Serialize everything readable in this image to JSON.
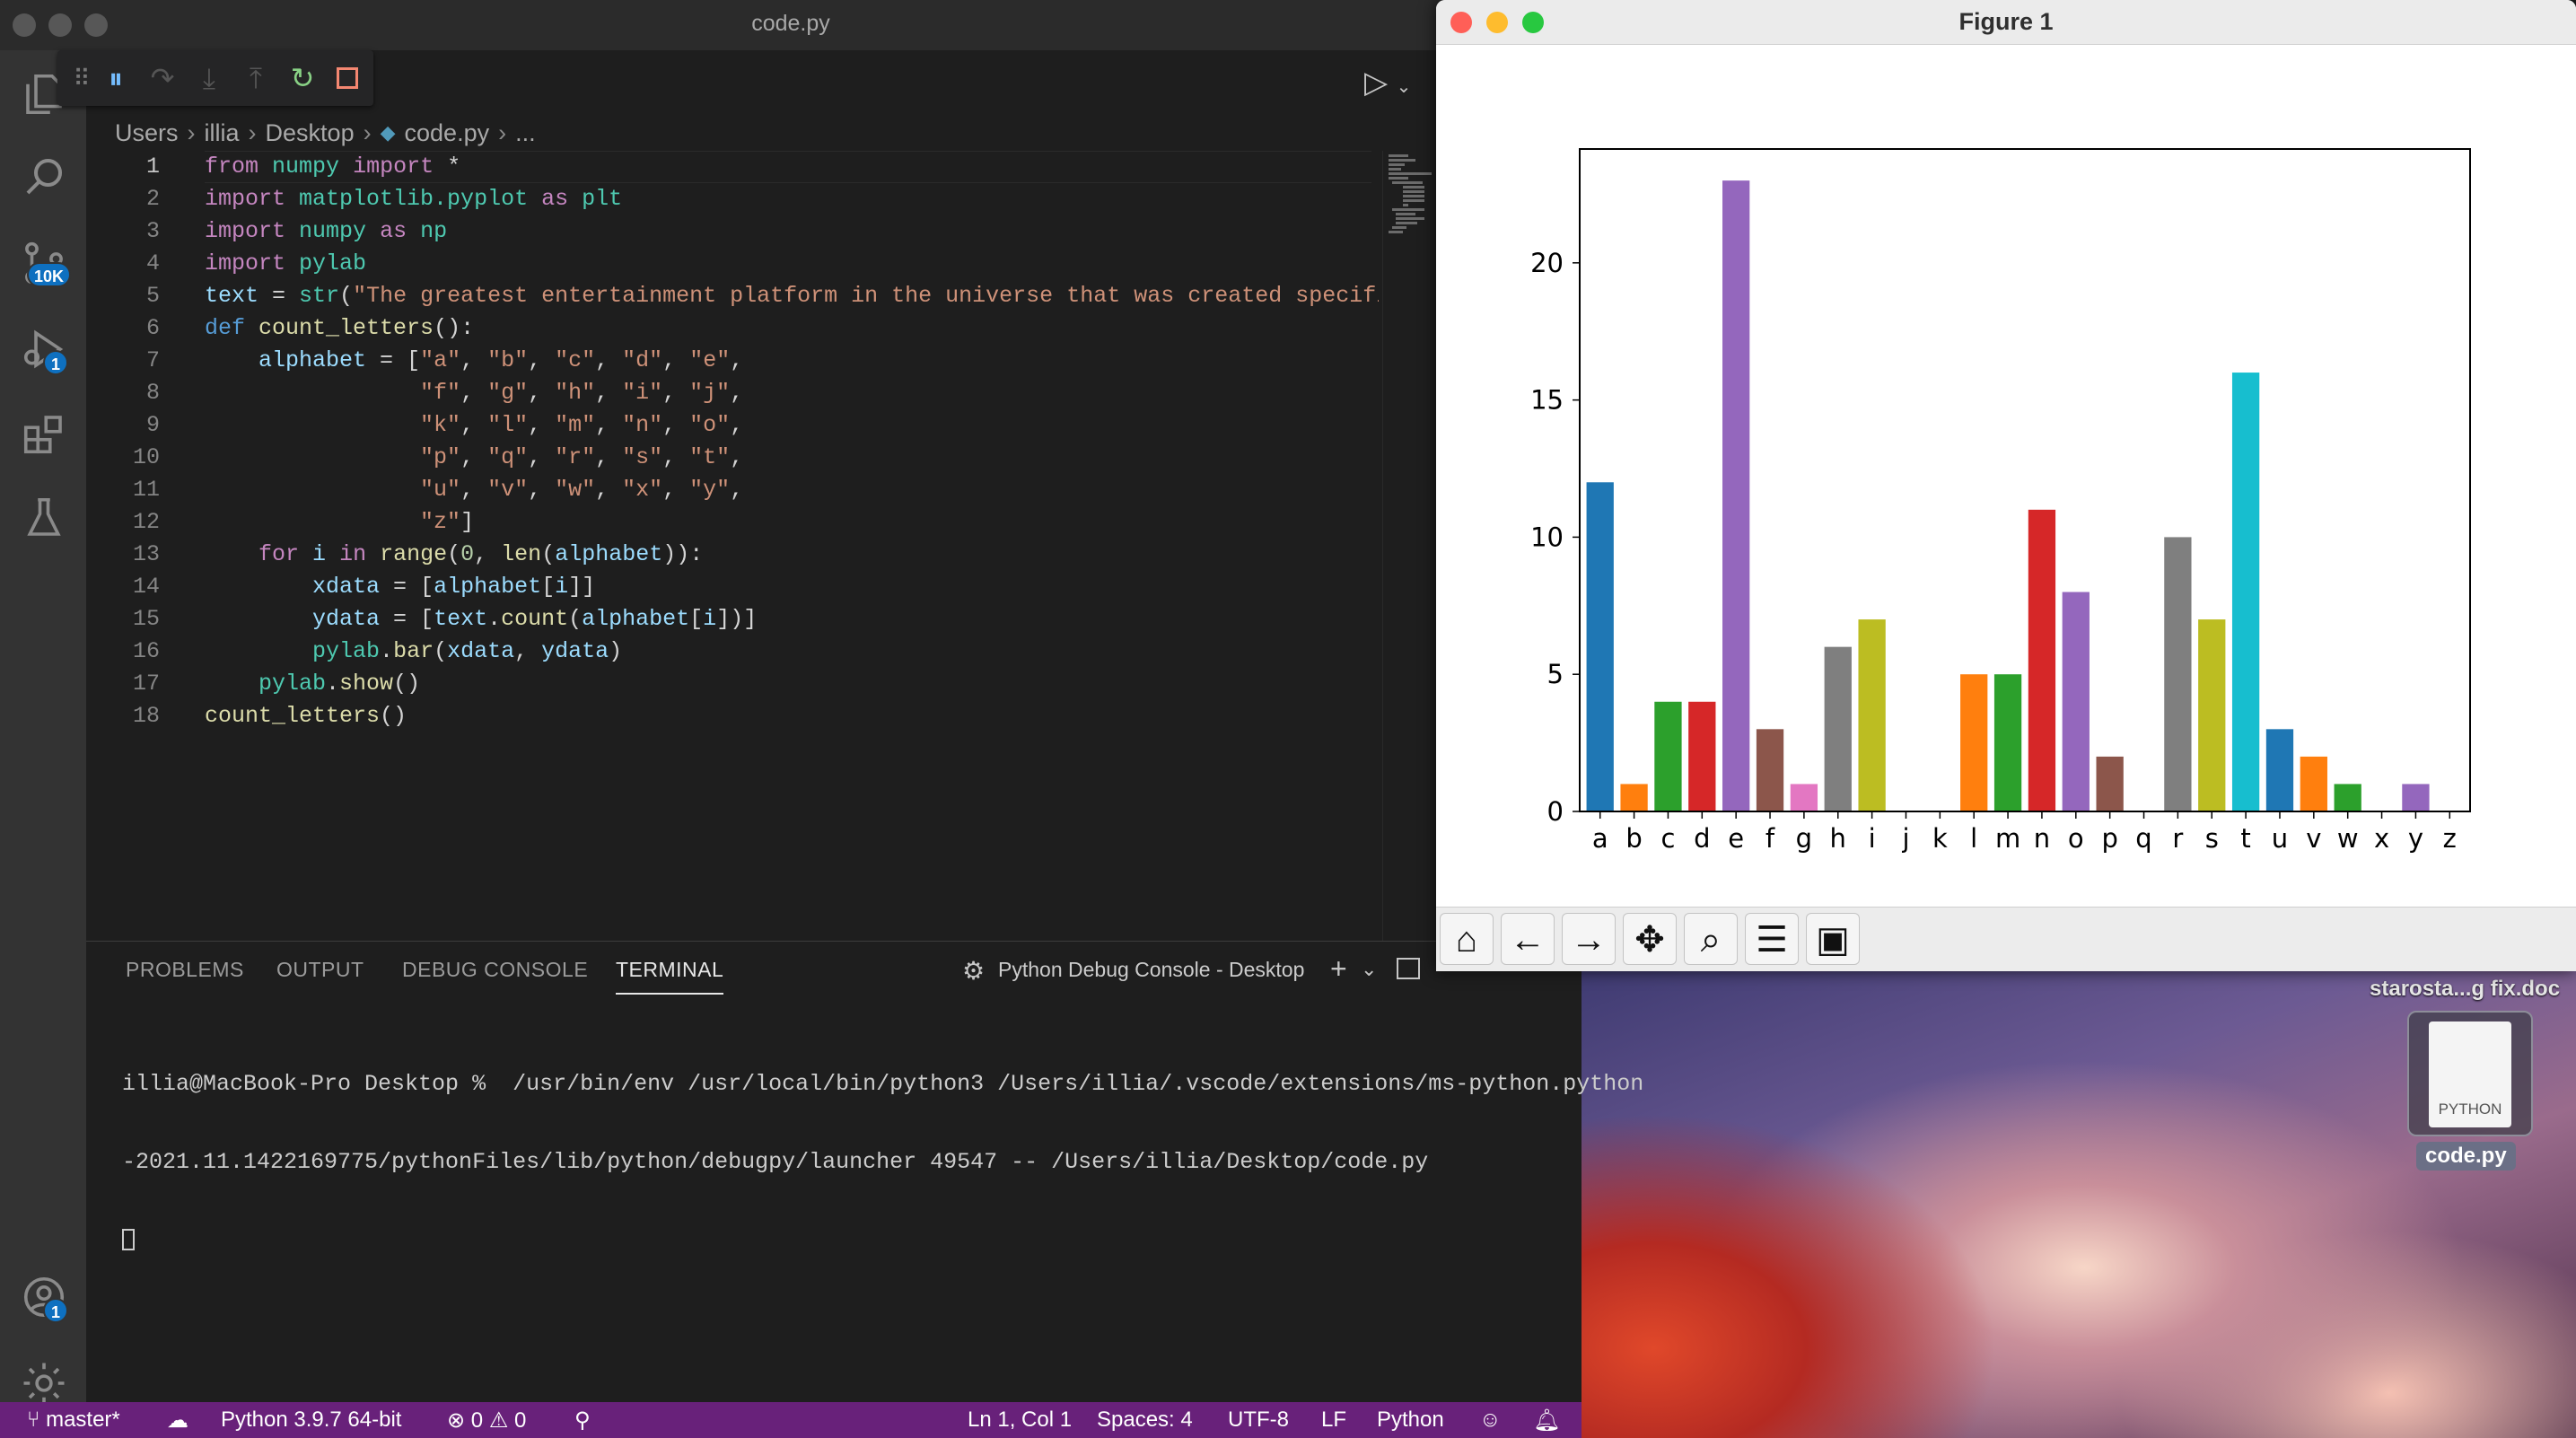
{
  "vscode": {
    "title": "code.py",
    "breadcrumb": [
      "Users",
      "illia",
      "Desktop",
      "code.py",
      "..."
    ],
    "activity_badges": {
      "source_control": "10K",
      "run_debug": "1",
      "accounts": "1"
    },
    "code_lines": [
      {
        "n": "1",
        "html": "<span class=\"k\">from</span> <span class=\"m\">numpy</span> <span class=\"k\">import</span> *"
      },
      {
        "n": "2",
        "html": "<span class=\"k\">import</span> <span class=\"m\">matplotlib.pyplot</span> <span class=\"k\">as</span> <span class=\"m\">plt</span>"
      },
      {
        "n": "3",
        "html": "<span class=\"k\">import</span> <span class=\"m\">numpy</span> <span class=\"k\">as</span> <span class=\"m\">np</span>"
      },
      {
        "n": "4",
        "html": "<span class=\"k\">import</span> <span class=\"m\">pylab</span>"
      },
      {
        "n": "5",
        "html": "<span class=\"v\">text</span> = <span class=\"m\">str</span>(<span class=\"s\">\"The greatest entertainment platform in the universe that was created specifical</span>"
      },
      {
        "n": "6",
        "html": "<span class=\"kb\">def</span> <span class=\"f\">count_letters</span>():"
      },
      {
        "n": "7",
        "html": "    <span class=\"v\">alphabet</span> = [<span class=\"s\">\"a\"</span>, <span class=\"s\">\"b\"</span>, <span class=\"s\">\"c\"</span>, <span class=\"s\">\"d\"</span>, <span class=\"s\">\"e\"</span>,"
      },
      {
        "n": "8",
        "html": "                <span class=\"s\">\"f\"</span>, <span class=\"s\">\"g\"</span>, <span class=\"s\">\"h\"</span>, <span class=\"s\">\"i\"</span>, <span class=\"s\">\"j\"</span>,"
      },
      {
        "n": "9",
        "html": "                <span class=\"s\">\"k\"</span>, <span class=\"s\">\"l\"</span>, <span class=\"s\">\"m\"</span>, <span class=\"s\">\"n\"</span>, <span class=\"s\">\"o\"</span>,"
      },
      {
        "n": "10",
        "html": "                <span class=\"s\">\"p\"</span>, <span class=\"s\">\"q\"</span>, <span class=\"s\">\"r\"</span>, <span class=\"s\">\"s\"</span>, <span class=\"s\">\"t\"</span>,"
      },
      {
        "n": "11",
        "html": "                <span class=\"s\">\"u\"</span>, <span class=\"s\">\"v\"</span>, <span class=\"s\">\"w\"</span>, <span class=\"s\">\"x\"</span>, <span class=\"s\">\"y\"</span>,"
      },
      {
        "n": "12",
        "html": "                <span class=\"s\">\"z\"</span>]"
      },
      {
        "n": "13",
        "html": "    <span class=\"k\">for</span> <span class=\"v\">i</span> <span class=\"k\">in</span> <span class=\"f\">range</span>(<span class=\"n\">0</span>, <span class=\"f\">len</span>(<span class=\"v\">alphabet</span>)):"
      },
      {
        "n": "14",
        "html": "        <span class=\"v\">xdata</span> = [<span class=\"v\">alphabet</span>[<span class=\"v\">i</span>]]"
      },
      {
        "n": "15",
        "html": "        <span class=\"v\">ydata</span> = [<span class=\"v\">text</span>.<span class=\"f\">count</span>(<span class=\"v\">alphabet</span>[<span class=\"v\">i</span>])]"
      },
      {
        "n": "16",
        "html": "        <span class=\"m\">pylab</span>.<span class=\"f\">bar</span>(<span class=\"v\">xdata</span>, <span class=\"v\">ydata</span>)"
      },
      {
        "n": "17",
        "html": "    <span class=\"m\">pylab</span>.<span class=\"f\">show</span>()"
      },
      {
        "n": "18",
        "html": "<span class=\"f\">count_letters</span>()"
      }
    ],
    "panel": {
      "tabs": [
        "PROBLEMS",
        "OUTPUT",
        "DEBUG CONSOLE",
        "TERMINAL"
      ],
      "active_tab": "TERMINAL",
      "terminal_selector": "Python Debug Console - Desktop",
      "terminal_lines": [
        "illia@MacBook-Pro Desktop %  /usr/bin/env /usr/local/bin/python3 /Users/illia/.vscode/extensions/ms-python.python",
        "-2021.11.1422169775/pythonFiles/lib/python/debugpy/launcher 49547 -- /Users/illia/Desktop/code.py"
      ]
    },
    "statusbar": {
      "branch": "master*",
      "interpreter": "Python 3.9.7 64-bit",
      "errors": "0",
      "warnings": "0",
      "position": "Ln 1, Col 1",
      "spaces": "Spaces: 4",
      "encoding": "UTF-8",
      "eol": "LF",
      "language": "Python"
    }
  },
  "figure": {
    "title": "Figure 1",
    "toolbar": [
      "home-icon",
      "back-icon",
      "forward-icon",
      "pan-icon",
      "zoom-icon",
      "configure-icon",
      "save-icon"
    ]
  },
  "desktop": {
    "file_title": "starosta...g fix.doc",
    "file_tag": "PYTHON",
    "file_label": "code.py"
  },
  "chart_data": {
    "type": "bar",
    "categories": [
      "a",
      "b",
      "c",
      "d",
      "e",
      "f",
      "g",
      "h",
      "i",
      "j",
      "k",
      "l",
      "m",
      "n",
      "o",
      "p",
      "q",
      "r",
      "s",
      "t",
      "u",
      "v",
      "w",
      "x",
      "y",
      "z"
    ],
    "values": [
      12,
      1,
      4,
      4,
      23,
      3,
      1,
      6,
      7,
      0,
      0,
      5,
      5,
      11,
      8,
      2,
      0,
      10,
      7,
      16,
      3,
      2,
      1,
      0,
      1,
      0
    ],
    "colors": [
      "#1f77b4",
      "#ff7f0e",
      "#2ca02c",
      "#d62728",
      "#9467bd",
      "#8c564b",
      "#e377c2",
      "#7f7f7f",
      "#bcbd22",
      "#17becf",
      "#1f77b4",
      "#ff7f0e",
      "#2ca02c",
      "#d62728",
      "#9467bd",
      "#8c564b",
      "#e377c2",
      "#7f7f7f",
      "#bcbd22",
      "#17becf",
      "#1f77b4",
      "#ff7f0e",
      "#2ca02c",
      "#d62728",
      "#9467bd",
      "#8c564b"
    ],
    "yticks": [
      0,
      5,
      10,
      15,
      20
    ],
    "ylim": [
      0,
      24.15
    ],
    "grid": false
  }
}
